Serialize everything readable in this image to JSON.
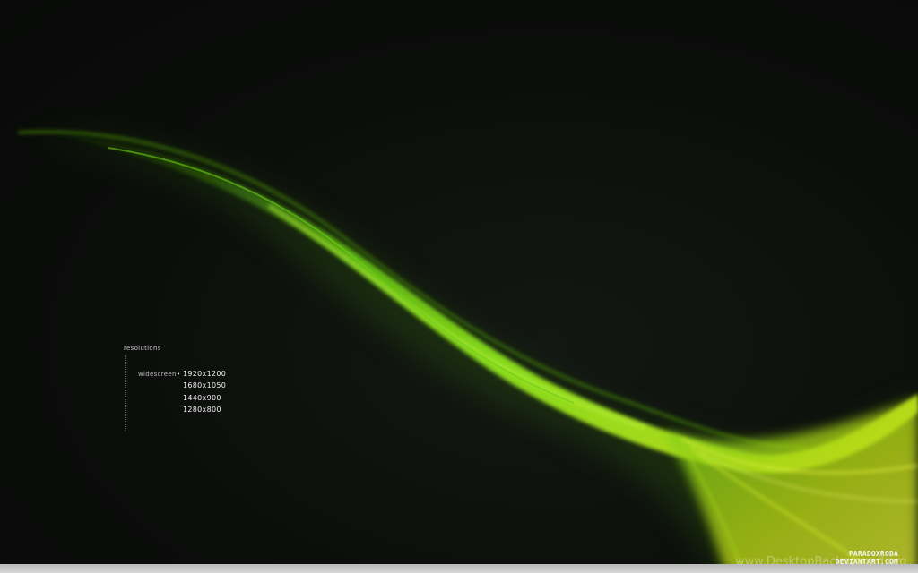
{
  "resolutions": {
    "title": "resolutions",
    "category": "widescreen",
    "bullet": "•",
    "items": [
      "1920x1200",
      "1680x1050",
      "1440x900",
      "1280x800"
    ]
  },
  "credit": {
    "line1": "PARADOXRODA",
    "line2": "DEVIANTART.COM"
  },
  "watermark": "www.DesktopBackground.org",
  "colors": {
    "background": "#0d0f0d",
    "wave_bright": "#7ddc18",
    "wave_yellow": "#d8e61a",
    "wave_dark": "#2f6a0a"
  }
}
